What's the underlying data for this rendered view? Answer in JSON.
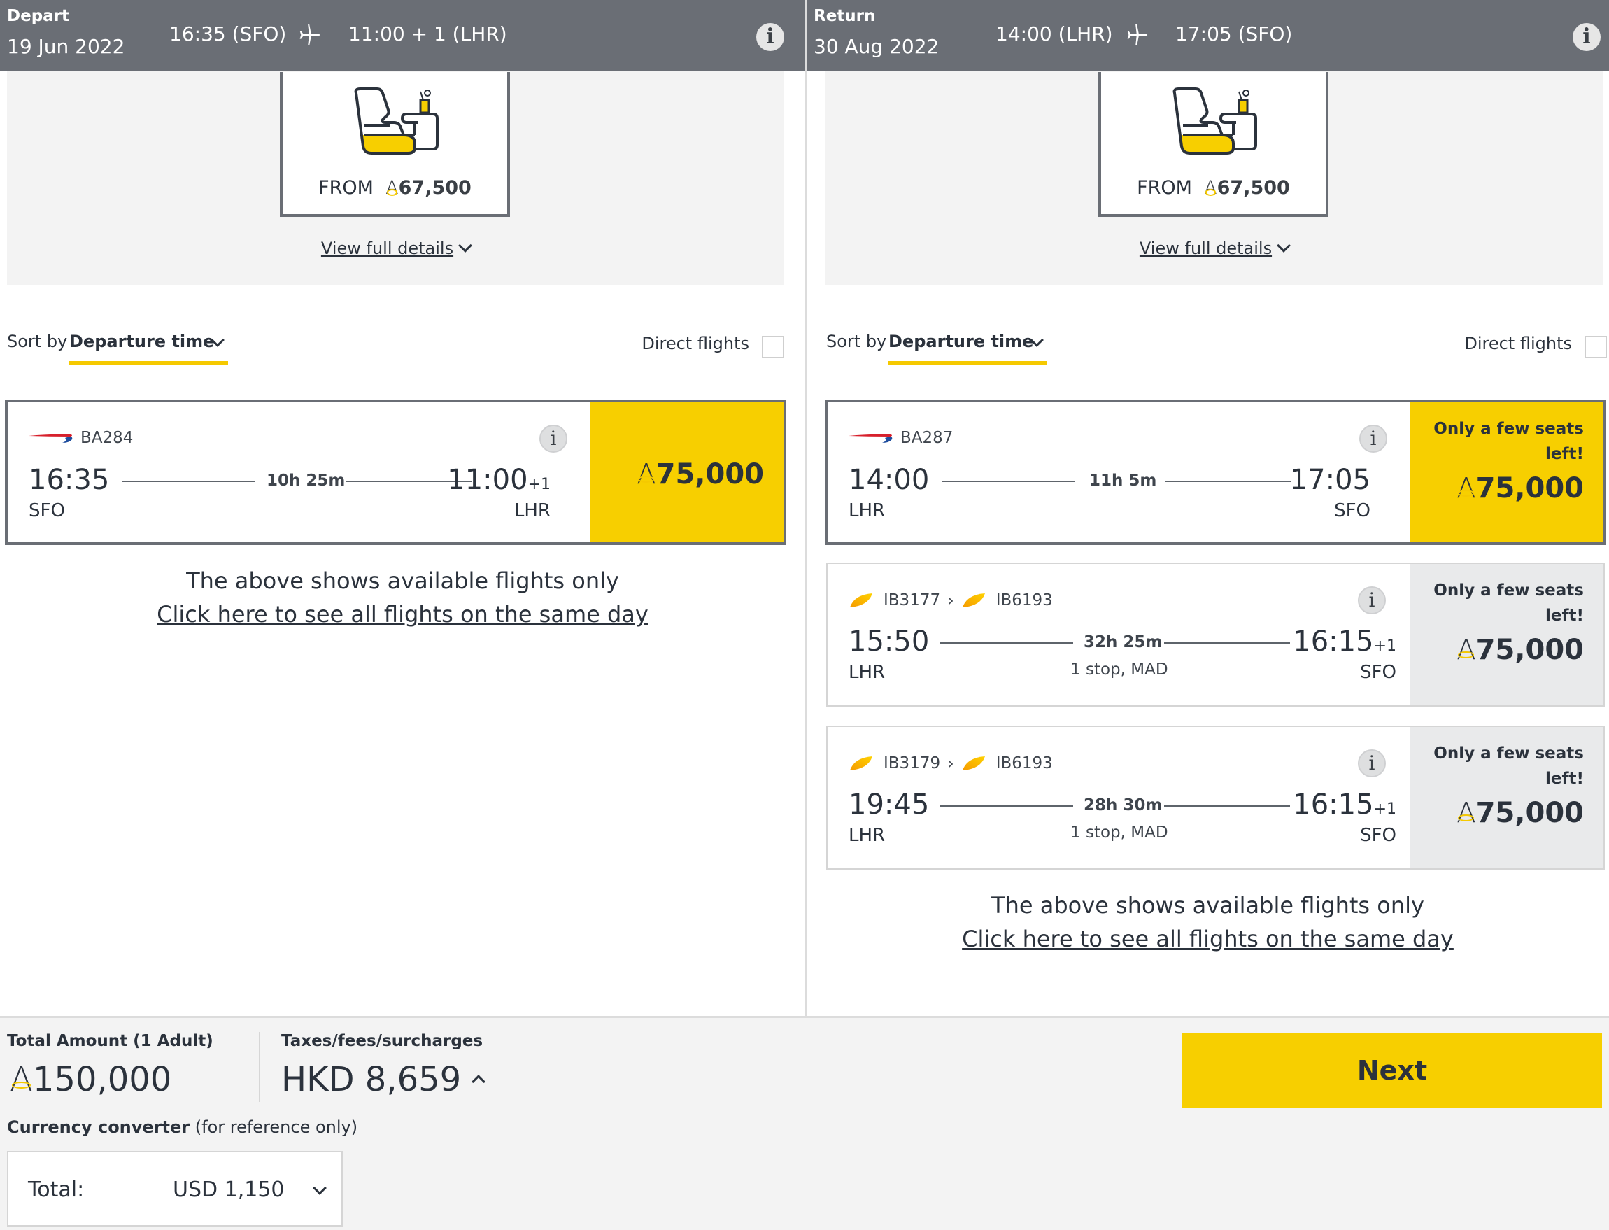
{
  "currency_symbol": "A",
  "depart": {
    "label": "Depart",
    "date": "19 Jun 2022",
    "dep_time": "16:35 (SFO)",
    "arr_time": "11:00 + 1 (LHR)",
    "cabin": {
      "from_label": "FROM",
      "from_amount": "67,500",
      "details_link": "View full details"
    },
    "sort": {
      "label": "Sort by",
      "value": "Departure time"
    },
    "direct_flights_label": "Direct flights",
    "direct_flights_checked": false,
    "flights": [
      {
        "flight_numbers": [
          "BA284"
        ],
        "airline": "British Airways",
        "dep_time": "16:35",
        "dep_airport": "SFO",
        "arr_time": "11:00",
        "arr_day_offset": "+1",
        "arr_airport": "LHR",
        "duration": "10h 25m",
        "stops": "",
        "availability_note": "",
        "price": "75,000",
        "selected": true
      }
    ],
    "available_note": "The above shows available flights only",
    "all_flights_link": "Click here to see all flights on the same day"
  },
  "return": {
    "label": "Return",
    "date": "30 Aug 2022",
    "dep_time": "14:00 (LHR)",
    "arr_time": "17:05 (SFO)",
    "cabin": {
      "from_label": "FROM",
      "from_amount": "67,500",
      "details_link": "View full details"
    },
    "sort": {
      "label": "Sort by",
      "value": "Departure time"
    },
    "direct_flights_label": "Direct flights",
    "direct_flights_checked": false,
    "flights": [
      {
        "flight_numbers": [
          "BA287"
        ],
        "airline": "British Airways",
        "dep_time": "14:00",
        "dep_airport": "LHR",
        "arr_time": "17:05",
        "arr_day_offset": "",
        "arr_airport": "SFO",
        "duration": "11h 5m",
        "stops": "",
        "availability_note": "Only a few seats left!",
        "price": "75,000",
        "selected": true
      },
      {
        "flight_numbers": [
          "IB3177",
          "IB6193"
        ],
        "airline": "Iberia",
        "dep_time": "15:50",
        "dep_airport": "LHR",
        "arr_time": "16:15",
        "arr_day_offset": "+1",
        "arr_airport": "SFO",
        "duration": "32h 25m",
        "stops": "1 stop, MAD",
        "availability_note": "Only a few seats left!",
        "price": "75,000",
        "selected": false
      },
      {
        "flight_numbers": [
          "IB3179",
          "IB6193"
        ],
        "airline": "Iberia",
        "dep_time": "19:45",
        "dep_airport": "LHR",
        "arr_time": "16:15",
        "arr_day_offset": "+1",
        "arr_airport": "SFO",
        "duration": "28h 30m",
        "stops": "1 stop, MAD",
        "availability_note": "Only a few seats left!",
        "price": "75,000",
        "selected": false
      }
    ],
    "available_note": "The above shows available flights only",
    "all_flights_link": "Click here to see all flights on the same day"
  },
  "footer": {
    "total_label": "Total Amount (1 Adult)",
    "total_amount": "150,000",
    "taxes_label": "Taxes/fees/surcharges",
    "taxes_amount": "HKD 8,659",
    "converter_label": "Currency converter",
    "converter_note": "(for reference only)",
    "converter_total_label": "Total:",
    "converter_total_value": "USD 1,150",
    "next_label": "Next"
  },
  "colors": {
    "header": "#6a6e75",
    "accent": "#f7cf00",
    "panel": "#f3f3f3",
    "text": "#2b323c"
  }
}
